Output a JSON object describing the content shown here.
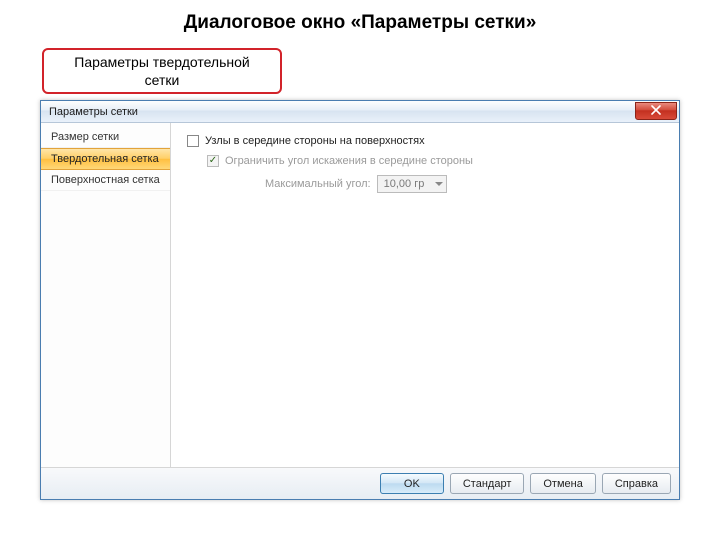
{
  "slide": {
    "title": "Диалоговое окно «Параметры сетки»",
    "callout": "Параметры твердотельной\nсетки"
  },
  "dialog": {
    "title": "Параметры сетки",
    "close_label": "Закрыть"
  },
  "sidebar": {
    "items": [
      {
        "label": "Размер сетки"
      },
      {
        "label": "Твердотельная сетка"
      },
      {
        "label": "Поверхностная сетка"
      }
    ]
  },
  "content": {
    "row1_label": "Узлы в середине стороны на поверхностях",
    "row2_label": "Ограничить угол искажения в середине стороны",
    "max_angle_label": "Максимальный угол:",
    "max_angle_value": "10,00 гр"
  },
  "buttons": {
    "ok": "OK",
    "standard": "Стандарт",
    "cancel": "Отмена",
    "help": "Справка"
  }
}
